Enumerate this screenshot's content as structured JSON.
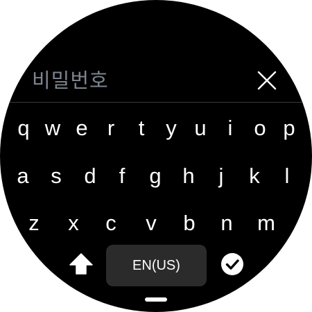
{
  "input": {
    "placeholder": "비밀번호"
  },
  "keyboard": {
    "rows": [
      [
        "q",
        "w",
        "e",
        "r",
        "t",
        "y",
        "u",
        "i",
        "o",
        "p"
      ],
      [
        "a",
        "s",
        "d",
        "f",
        "g",
        "h",
        "j",
        "k",
        "l"
      ],
      [
        "z",
        "x",
        "c",
        "v",
        "b",
        "n",
        "m"
      ]
    ],
    "language_label": "EN(US)"
  },
  "icons": {
    "clear": "close-icon",
    "shift": "shift-arrow-up-icon",
    "enter": "checkmark-circle-icon"
  },
  "colors": {
    "background": "#000000",
    "placeholder_text": "#7d858f",
    "key_text": "#ffffff",
    "language_key_bg": "#2b2b2b"
  }
}
